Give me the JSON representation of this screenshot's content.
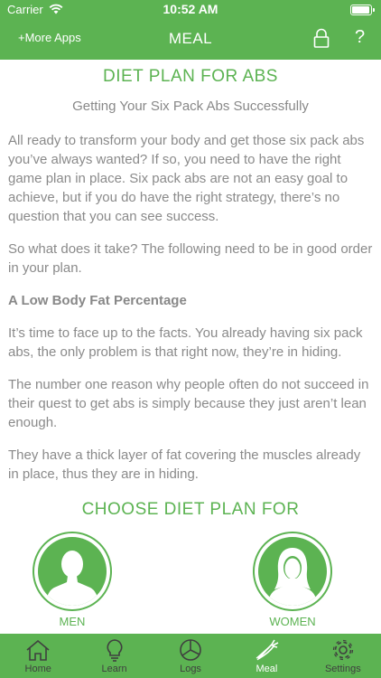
{
  "status_bar": {
    "carrier": "Carrier",
    "time": "10:52 AM"
  },
  "nav": {
    "more_apps": "+More Apps",
    "title": "MEAL",
    "help": "?"
  },
  "content": {
    "title": "DIET PLAN FOR ABS",
    "subtitle": "Getting Your Six Pack Abs Successfully",
    "paragraphs": [
      "All ready to transform your body and get those six pack abs you’ve always wanted? If so, you need to have the right game plan in place. Six pack abs are not an easy goal to achieve, but if you do have the right strategy, there’s no question that you can see success.",
      "So what does it take? The following need to be in good order in your plan."
    ],
    "section_heading": "A Low Body Fat Percentage",
    "section_paragraphs": [
      "It’s time to face up to the facts. You already having six pack abs, the only problem is that right now, they’re in hiding.",
      "The number one reason why people often do not succeed in their quest to get abs is simply because they just aren’t lean enough.",
      "They have a thick layer of fat covering the muscles already in place, thus they are in hiding."
    ]
  },
  "choose": {
    "title": "CHOOSE DIET PLAN FOR",
    "men_label": "MEN",
    "women_label": "WOMEN"
  },
  "tabs": [
    {
      "label": "Home",
      "icon": "home-icon"
    },
    {
      "label": "Learn",
      "icon": "lightbulb-icon"
    },
    {
      "label": "Logs",
      "icon": "pie-chart-icon"
    },
    {
      "label": "Meal",
      "icon": "carrot-icon",
      "active": true
    },
    {
      "label": "Settings",
      "icon": "gear-icon"
    }
  ],
  "colors": {
    "brand_green": "#5cb352",
    "body_text": "#8a8a8a",
    "tab_inactive": "#3f3f3f",
    "tab_active": "#ffffff"
  }
}
